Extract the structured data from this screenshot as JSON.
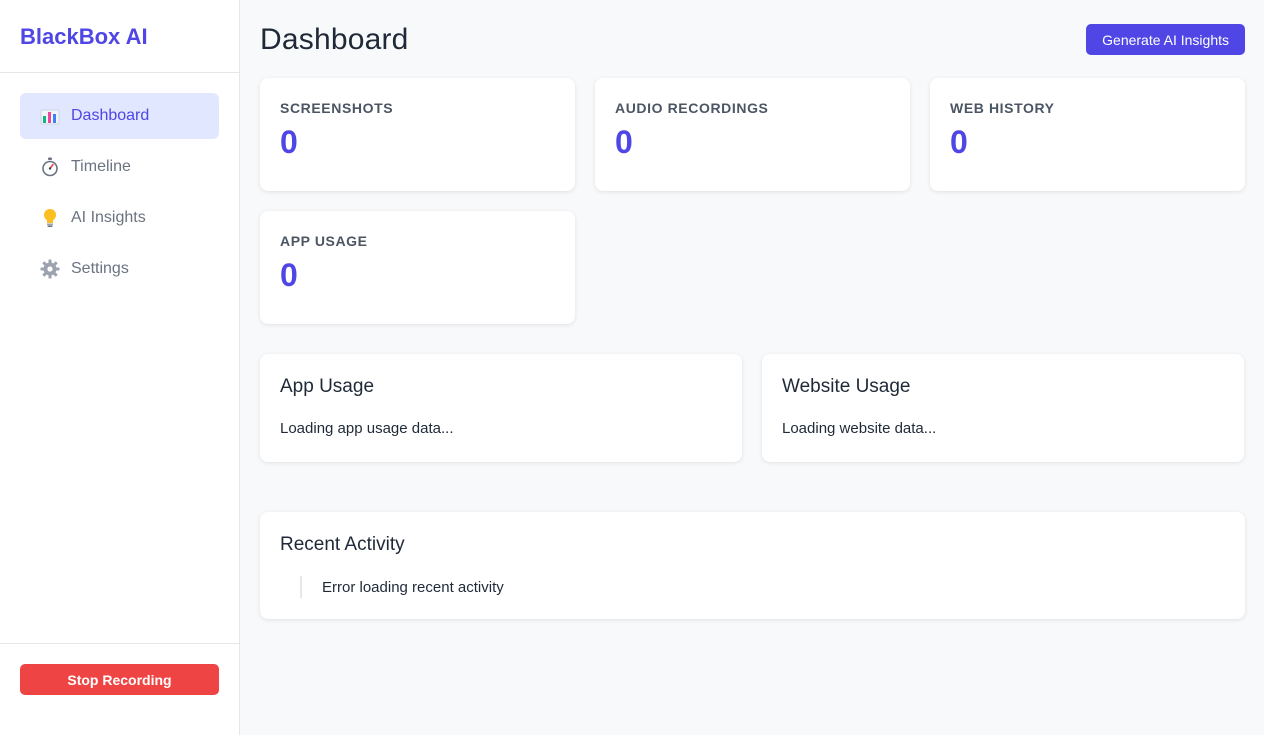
{
  "app": {
    "brand": "BlackBox AI"
  },
  "sidebar": {
    "items": [
      {
        "label": "Dashboard",
        "icon": "chart-bars-icon",
        "active": true
      },
      {
        "label": "Timeline",
        "icon": "stopwatch-icon",
        "active": false
      },
      {
        "label": "AI Insights",
        "icon": "lightbulb-icon",
        "active": false
      },
      {
        "label": "Settings",
        "icon": "gear-icon",
        "active": false
      }
    ],
    "stop_label": "Stop Recording"
  },
  "header": {
    "title": "Dashboard",
    "generate_label": "Generate AI Insights"
  },
  "stats": [
    {
      "label": "SCREENSHOTS",
      "value": "0"
    },
    {
      "label": "AUDIO RECORDINGS",
      "value": "0"
    },
    {
      "label": "WEB HISTORY",
      "value": "0"
    },
    {
      "label": "APP USAGE",
      "value": "0"
    }
  ],
  "usage": {
    "app": {
      "title": "App Usage",
      "text": "Loading app usage data..."
    },
    "web": {
      "title": "Website Usage",
      "text": "Loading website data..."
    }
  },
  "activity": {
    "title": "Recent Activity",
    "items": [
      "Error loading recent activity"
    ]
  },
  "colors": {
    "accent": "#4f46e5",
    "danger": "#ef4444",
    "active_bg": "#e0e7ff"
  }
}
